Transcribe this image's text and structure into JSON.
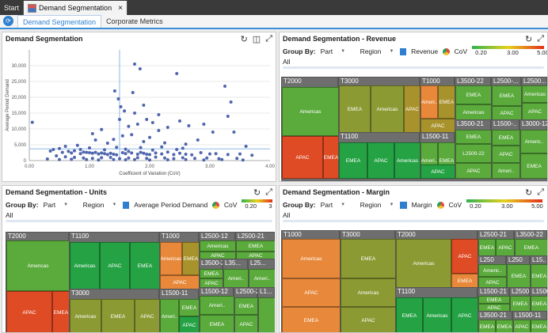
{
  "titlebar": {
    "start_label": "Start",
    "tab_label": "Demand Segmentation",
    "close_glyph": "×"
  },
  "subtabs": [
    {
      "label": "Demand Segmentation",
      "active": true
    },
    {
      "label": "Corporate Metrics",
      "active": false
    }
  ],
  "icons": [
    "refresh-icon",
    "layout-icon",
    "expand-icon"
  ],
  "scatter": {
    "title": "Demand Segmentation",
    "chart_data": {
      "type": "scatter",
      "title": "",
      "xlabel": "Coefficient of Variation (CoV)",
      "ylabel": "Average Period Demand",
      "xlim": [
        0,
        4
      ],
      "ylim": [
        0,
        35000
      ],
      "xticks": [
        "0.00",
        "1.00",
        "2.00",
        "3.00",
        "4.00"
      ],
      "yticks": [
        "0",
        "5,000",
        "10,000",
        "15,000",
        "20,000",
        "25,000",
        "30,000"
      ],
      "ref_x": 1.5,
      "ref_y": 3700,
      "points": [
        [
          0.05,
          12100
        ],
        [
          1.42,
          22000
        ],
        [
          1.48,
          19500
        ],
        [
          1.52,
          17000
        ],
        [
          1.58,
          15700
        ],
        [
          1.75,
          30500
        ],
        [
          1.72,
          21500
        ],
        [
          1.84,
          29000
        ],
        [
          1.9,
          17500
        ],
        [
          1.95,
          13000
        ],
        [
          2.05,
          12000
        ],
        [
          2.15,
          9500
        ],
        [
          2.45,
          27500
        ],
        [
          2.3,
          10500
        ],
        [
          2.5,
          12500
        ],
        [
          2.65,
          11000
        ],
        [
          2.9,
          11500
        ],
        [
          3.25,
          23500
        ],
        [
          3.35,
          18500
        ],
        [
          3.4,
          9000
        ],
        [
          3.05,
          9000
        ],
        [
          2.8,
          6500
        ],
        [
          3.6,
          4500
        ],
        [
          1.3,
          5500
        ],
        [
          1.1,
          6500
        ],
        [
          0.8,
          4800
        ],
        [
          0.6,
          4500
        ],
        [
          0.5,
          3800
        ],
        [
          0.4,
          3500
        ],
        [
          0.35,
          3000
        ],
        [
          0.55,
          2600
        ],
        [
          0.65,
          2900
        ],
        [
          0.7,
          2400
        ],
        [
          0.75,
          3100
        ],
        [
          0.85,
          2200
        ],
        [
          0.9,
          2700
        ],
        [
          0.95,
          2600
        ],
        [
          1.0,
          2500
        ],
        [
          1.05,
          2300
        ],
        [
          1.1,
          2600
        ],
        [
          1.15,
          2100
        ],
        [
          1.2,
          2400
        ],
        [
          1.25,
          2200
        ],
        [
          1.3,
          1900
        ],
        [
          1.35,
          2300
        ],
        [
          1.4,
          2000
        ],
        [
          1.45,
          1800
        ],
        [
          1.55,
          2500
        ],
        [
          1.6,
          2200
        ],
        [
          1.65,
          2900
        ],
        [
          1.7,
          2400
        ],
        [
          1.8,
          2000
        ],
        [
          1.85,
          2600
        ],
        [
          1.9,
          2300
        ],
        [
          1.95,
          2000
        ],
        [
          2.0,
          1900
        ],
        [
          2.1,
          2400
        ],
        [
          2.2,
          2100
        ],
        [
          2.3,
          2700
        ],
        [
          2.4,
          1900
        ],
        [
          2.5,
          2300
        ],
        [
          2.6,
          2000
        ],
        [
          2.7,
          1800
        ],
        [
          2.85,
          2500
        ],
        [
          3.0,
          2100
        ],
        [
          3.1,
          2200
        ],
        [
          3.3,
          1900
        ],
        [
          3.5,
          2100
        ],
        [
          3.7,
          1700
        ],
        [
          0.45,
          1500
        ],
        [
          0.6,
          1200
        ],
        [
          0.75,
          1000
        ],
        [
          0.9,
          800
        ],
        [
          1.05,
          700
        ],
        [
          1.2,
          900
        ],
        [
          1.35,
          1000
        ],
        [
          1.5,
          600
        ],
        [
          1.65,
          800
        ],
        [
          1.8,
          900
        ],
        [
          1.95,
          700
        ],
        [
          2.1,
          1100
        ],
        [
          2.25,
          800
        ],
        [
          2.4,
          600
        ],
        [
          2.55,
          900
        ],
        [
          2.75,
          700
        ],
        [
          2.95,
          800
        ],
        [
          3.15,
          600
        ],
        [
          3.45,
          700
        ],
        [
          0.3,
          500
        ],
        [
          0.5,
          300
        ],
        [
          0.7,
          400
        ],
        [
          0.95,
          300
        ],
        [
          1.15,
          200
        ],
        [
          1.4,
          300
        ],
        [
          1.6,
          250
        ],
        [
          1.75,
          300
        ],
        [
          2.0,
          200
        ],
        [
          2.3,
          250
        ],
        [
          2.6,
          300
        ],
        [
          2.9,
          200
        ],
        [
          3.2,
          300
        ],
        [
          3.55,
          200
        ],
        [
          1.0,
          4000
        ],
        [
          1.45,
          4200
        ],
        [
          1.85,
          4100
        ],
        [
          2.2,
          4300
        ],
        [
          2.55,
          3900
        ],
        [
          1.25,
          3400
        ],
        [
          1.6,
          3600
        ],
        [
          2.05,
          3300
        ],
        [
          2.45,
          3500
        ],
        [
          0.85,
          3500
        ],
        [
          1.55,
          7800
        ],
        [
          1.7,
          8200
        ],
        [
          2.0,
          7300
        ],
        [
          1.9,
          6000
        ],
        [
          2.25,
          5600
        ],
        [
          1.4,
          6700
        ],
        [
          2.6,
          5200
        ],
        [
          1.05,
          8500
        ],
        [
          1.2,
          9800
        ],
        [
          1.65,
          10800
        ],
        [
          1.8,
          11500
        ],
        [
          1.5,
          13000
        ],
        [
          2.15,
          14500
        ],
        [
          1.75,
          15000
        ],
        [
          3.3,
          14000
        ]
      ]
    }
  },
  "revenue": {
    "title": "Demand Segmentation - Revenue",
    "group_by_label": "Group By:",
    "group_value": "Part",
    "region_value": "Region",
    "metric_label": "Revenue",
    "cov_label": "CoV",
    "legend_ticks": [
      "0.20",
      "3.00",
      "5.00"
    ],
    "all_label": "All"
  },
  "units": {
    "title": "Demand Segmentation - Units",
    "group_by_label": "Group By:",
    "group_value": "Part",
    "region_value": "Region",
    "metric_label": "Average Period Demand",
    "cov_label": "CoV",
    "legend_ticks": [
      "0.20",
      "3"
    ],
    "all_label": "All"
  },
  "margin": {
    "title": "Demand Segmentation - Margin",
    "group_by_label": "Group By:",
    "group_value": "Part",
    "region_value": "Region",
    "metric_label": "Margin",
    "cov_label": "CoV",
    "legend_ticks": [
      "0.20",
      "3.00",
      "5.00"
    ],
    "all_label": "All"
  },
  "palette": {
    "dg": "#25a244",
    "g": "#5aaa3c",
    "ol": "#8c9a34",
    "yo": "#a8922c",
    "or": "#e8883a",
    "rd": "#de4b25"
  },
  "treemaps": {
    "revenue": [
      {
        "label": "T2000",
        "cells": [
          {
            "t": "Americas",
            "c": "g"
          },
          {
            "t": "APAC",
            "c": "rd"
          },
          {
            "t": "EMEA",
            "c": "rd"
          }
        ]
      },
      {
        "label": "T3000",
        "cells": [
          {
            "t": "EMEA",
            "c": "ol"
          },
          {
            "t": "Americas",
            "c": "ol"
          },
          {
            "t": "APAC",
            "c": "yo"
          }
        ]
      },
      {
        "label": "T1000",
        "cells": [
          {
            "t": "Ameri..",
            "c": "or"
          },
          {
            "t": "EMEA",
            "c": "yo"
          },
          {
            "t": "APAC",
            "c": "yo"
          }
        ]
      },
      {
        "label": "L3500-22",
        "cells": [
          {
            "t": "EMEA",
            "c": "g"
          },
          {
            "t": "Americas",
            "c": "g"
          }
        ]
      },
      {
        "label": "L2500-...",
        "cells": [
          {
            "t": "EMEA",
            "c": "g"
          },
          {
            "t": "APAC",
            "c": "g"
          }
        ]
      },
      {
        "label": "L2500...",
        "cells": [
          {
            "t": "Americas",
            "c": "g"
          },
          {
            "t": "APAC",
            "c": "g"
          }
        ]
      },
      {
        "label": "T1100",
        "cells": [
          {
            "t": "EMEA",
            "c": "dg"
          },
          {
            "t": "APAC",
            "c": "dg"
          },
          {
            "t": "Americas",
            "c": "dg"
          }
        ]
      },
      {
        "label": "L1500-11",
        "cells": [
          {
            "t": "Ameri..",
            "c": "g"
          },
          {
            "t": "EMEA",
            "c": "g"
          },
          {
            "t": "APAC",
            "c": "dg"
          }
        ]
      },
      {
        "label": "L3500-21",
        "cells": [
          {
            "t": "EMEA",
            "c": "g"
          },
          {
            "t": "L2500-22",
            "c": "g"
          },
          {
            "t": "APAC",
            "c": "g"
          }
        ]
      },
      {
        "label": "L1500-..",
        "cells": [
          {
            "t": "EMEA",
            "c": "g"
          },
          {
            "t": "APAC",
            "c": "g"
          },
          {
            "t": "Ameri..",
            "c": "g"
          }
        ]
      },
      {
        "label": "L3000-12",
        "cells": [
          {
            "t": "Americ..",
            "c": "g"
          },
          {
            "t": "EMEA",
            "c": "g"
          }
        ]
      }
    ],
    "units": [
      {
        "label": "T2000",
        "cells": [
          {
            "t": "Americas",
            "c": "g"
          },
          {
            "t": "APAC",
            "c": "rd"
          },
          {
            "t": "EMEA",
            "c": "rd"
          }
        ]
      },
      {
        "label": "T1100",
        "cells": [
          {
            "t": "Americas",
            "c": "dg"
          },
          {
            "t": "APAC",
            "c": "dg"
          },
          {
            "t": "EMEA",
            "c": "dg"
          }
        ]
      },
      {
        "label": "T1000",
        "cells": [
          {
            "t": "Americas",
            "c": "or"
          },
          {
            "t": "EMEA",
            "c": "yo"
          },
          {
            "t": "APAC",
            "c": "or"
          }
        ]
      },
      {
        "label": "L2500-12",
        "cells": [
          {
            "t": "Americas",
            "c": "g"
          },
          {
            "t": "APAC",
            "c": "g"
          }
        ]
      },
      {
        "label": "L2500-21",
        "cells": [
          {
            "t": "EMEA",
            "c": "g"
          },
          {
            "t": "APAC",
            "c": "g"
          }
        ]
      },
      {
        "label": "L3500-22",
        "cells": [
          {
            "t": "EMEA",
            "c": "g"
          },
          {
            "t": "APAC",
            "c": "g"
          }
        ]
      },
      {
        "label": "L35...",
        "cells": [
          {
            "t": "Ameri..",
            "c": "g"
          }
        ]
      },
      {
        "label": "L25...",
        "cells": [
          {
            "t": "Ameri..",
            "c": "g"
          }
        ]
      },
      {
        "label": "T3000",
        "cells": [
          {
            "t": "Americas",
            "c": "ol"
          },
          {
            "t": "EMEA",
            "c": "ol"
          },
          {
            "t": "APAC",
            "c": "ol"
          }
        ]
      },
      {
        "label": "L1500-11",
        "cells": [
          {
            "t": "Ameri..",
            "c": "g"
          },
          {
            "t": "EMEA",
            "c": "g"
          },
          {
            "t": "APAC",
            "c": "dg"
          }
        ]
      },
      {
        "label": "L1500-12",
        "cells": [
          {
            "t": "Ameri..",
            "c": "g"
          },
          {
            "t": "EMEA",
            "c": "g"
          }
        ]
      },
      {
        "label": "L2500-22",
        "cells": [
          {
            "t": "EMEA",
            "c": "g"
          },
          {
            "t": "APAC",
            "c": "g"
          }
        ]
      },
      {
        "label": "L1...",
        "cells": [
          {
            "t": "",
            "c": "g"
          }
        ]
      }
    ],
    "margin": [
      {
        "label": "T1000",
        "cells": [
          {
            "t": "Americas",
            "c": "or"
          },
          {
            "t": "APAC",
            "c": "or"
          },
          {
            "t": "EMEA",
            "c": "or"
          }
        ]
      },
      {
        "label": "T3000",
        "cells": [
          {
            "t": "EMEA",
            "c": "ol"
          },
          {
            "t": "Americas",
            "c": "ol"
          },
          {
            "t": "APAC",
            "c": "ol"
          }
        ]
      },
      {
        "label": "T2000",
        "cells": [
          {
            "t": "Americas",
            "c": "ol"
          },
          {
            "t": "APAC",
            "c": "rd"
          },
          {
            "t": "EMEA",
            "c": "or"
          }
        ]
      },
      {
        "label": "L2500-21",
        "cells": [
          {
            "t": "EMEA",
            "c": "g"
          },
          {
            "t": "APAC",
            "c": "g"
          }
        ]
      },
      {
        "label": "L3500-22",
        "cells": [
          {
            "t": "EMEA",
            "c": "g"
          }
        ]
      },
      {
        "label": "L250",
        "cells": [
          {
            "t": "Americ..",
            "c": "g"
          },
          {
            "t": "APAC",
            "c": "g"
          }
        ]
      },
      {
        "label": "L250",
        "cells": [
          {
            "t": "EMEA",
            "c": "g"
          }
        ]
      },
      {
        "label": "L15..",
        "cells": [
          {
            "t": "EMEA",
            "c": "g"
          }
        ]
      },
      {
        "label": "T1100",
        "cells": [
          {
            "t": "EMEA",
            "c": "dg"
          },
          {
            "t": "Americas",
            "c": "dg"
          },
          {
            "t": "APAC",
            "c": "dg"
          }
        ]
      },
      {
        "label": "L1500-21",
        "cells": [
          {
            "t": "EMEA",
            "c": "g"
          },
          {
            "t": "APAC",
            "c": "g"
          }
        ]
      },
      {
        "label": "L2500-11",
        "cells": [
          {
            "t": "EMEA",
            "c": "g"
          }
        ]
      },
      {
        "label": "L1500..",
        "cells": [
          {
            "t": "EMEA",
            "c": "g"
          }
        ]
      },
      {
        "label": "L3500-21",
        "cells": [
          {
            "t": "EMEA",
            "c": "g"
          },
          {
            "t": "EMEA",
            "c": "g"
          }
        ]
      },
      {
        "label": "L1500-11",
        "cells": [
          {
            "t": "APAC",
            "c": "g"
          },
          {
            "t": "EMEA",
            "c": "g"
          }
        ]
      }
    ]
  }
}
